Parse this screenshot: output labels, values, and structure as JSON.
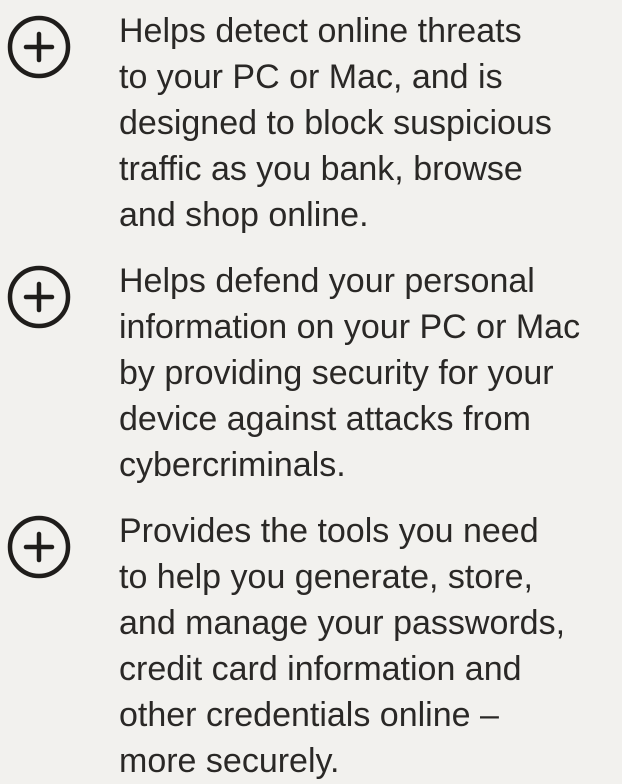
{
  "features": [
    {
      "icon": "plus-circle-icon",
      "description": "Helps detect online threats\nto your PC or Mac, and is\ndesigned to block suspicious\ntraffic as you bank, browse\nand shop online."
    },
    {
      "icon": "plus-circle-icon",
      "description": "Helps defend your personal\ninformation on your PC or Mac\nby providing security for your\ndevice against attacks from\ncybercriminals."
    },
    {
      "icon": "plus-circle-icon",
      "description": "Provides the tools you need\nto help you generate, store,\nand manage your passwords,\ncredit card information and\nother credentials online –\nmore securely."
    }
  ],
  "colors": {
    "background": "#f2f1ee",
    "text": "#2a2826",
    "icon": "#1f1d1b"
  }
}
